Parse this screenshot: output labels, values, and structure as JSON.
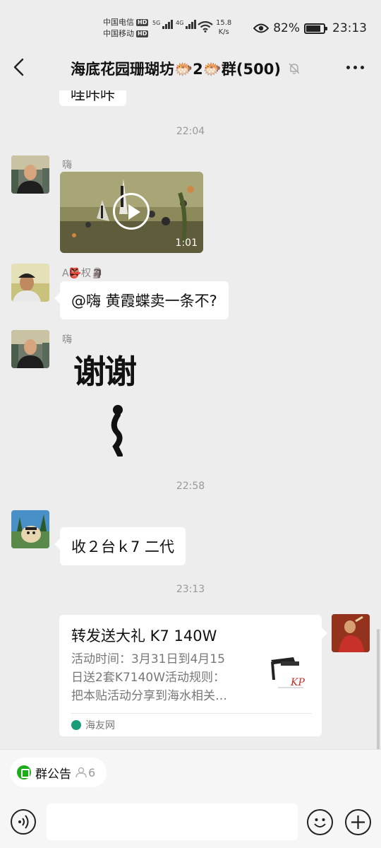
{
  "status_bar": {
    "carrier1": "中国电信",
    "carrier2": "中国移动",
    "hd": "HD",
    "net1": "5G",
    "net2": "4G",
    "speed_value": "15.8",
    "speed_unit": "K/s",
    "battery_percent": "82%",
    "battery_level": 0.82,
    "time": "23:13"
  },
  "header": {
    "title": "海底花园珊瑚坊🐡2🐡群(500)",
    "back_icon": "chevron-left-icon",
    "mute_icon": "bell-off-icon",
    "more_icon": "more-dots-icon"
  },
  "messages": {
    "partial_text": "哇咔咔",
    "ts1": "22:04",
    "m1_sender": "嗨",
    "m1_video_duration": "1:01",
    "m2_sender": "A👺权🗿",
    "m2_text": "@嗨  黄霞蝶卖一条不?",
    "m3_sender": "嗨",
    "m3_sticker_text": "谢谢",
    "ts2": "22:58",
    "m4_text": "收２台ｋ7 二代",
    "ts3": "23:13",
    "card": {
      "title": "转发送大礼 K7 140W",
      "desc_line1": "活动时间：3月31日到4月15",
      "desc_line2": "日送2套K7140W活动规则：",
      "desc_line3": "把本贴活动分享到海水相关…",
      "source": "海友网"
    }
  },
  "bottom": {
    "notice_label": "群公告",
    "notice_count": "6"
  },
  "colors": {
    "background": "#ededed",
    "bubble": "#ffffff",
    "accent_green": "#1aad19"
  }
}
